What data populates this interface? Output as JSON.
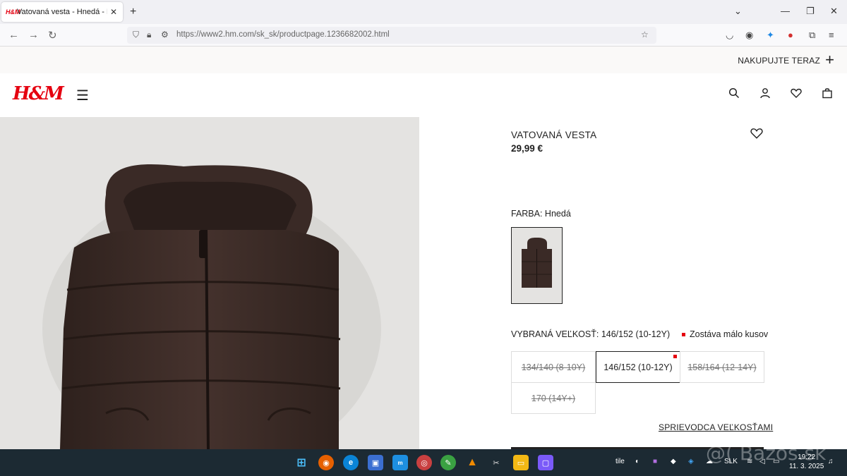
{
  "browser": {
    "tab_title": "Vatovaná vesta - Hnedá - DETI",
    "tab_favicon": "H&M",
    "url": "https://www2.hm.com/sk_sk/productpage.1236682002.html"
  },
  "promo": {
    "text": "NAKUPUJTE TERAZ"
  },
  "header": {
    "logo": "H&M"
  },
  "product": {
    "title": "VATOVANÁ VESTA",
    "price": "29,99 €",
    "color_label": "FARBA: Hnedá",
    "selected_size_label": "VYBRANÁ VEĽKOSŤ: 146/152 (10-12Y)",
    "low_stock_label": "Zostáva málo kusov",
    "sizes": [
      {
        "label": "134/140 (8-10Y)",
        "available": false
      },
      {
        "label": "146/152 (10-12Y)",
        "available": true,
        "selected": true
      },
      {
        "label": "158/164 (12-14Y)",
        "available": false
      },
      {
        "label": "170 (14Y+)",
        "available": false
      }
    ],
    "size_guide": "SPRIEVODCA VEĽKOSŤAMI"
  },
  "taskbar": {
    "tray_text": "tile",
    "language": "SLK",
    "time": "19:22",
    "date": "11. 3. 2025"
  },
  "watermark": "@( Bazos.sk",
  "colors": {
    "brand": "#e50010",
    "vest": "#3b2a26",
    "taskbar": "#1c2a33"
  }
}
